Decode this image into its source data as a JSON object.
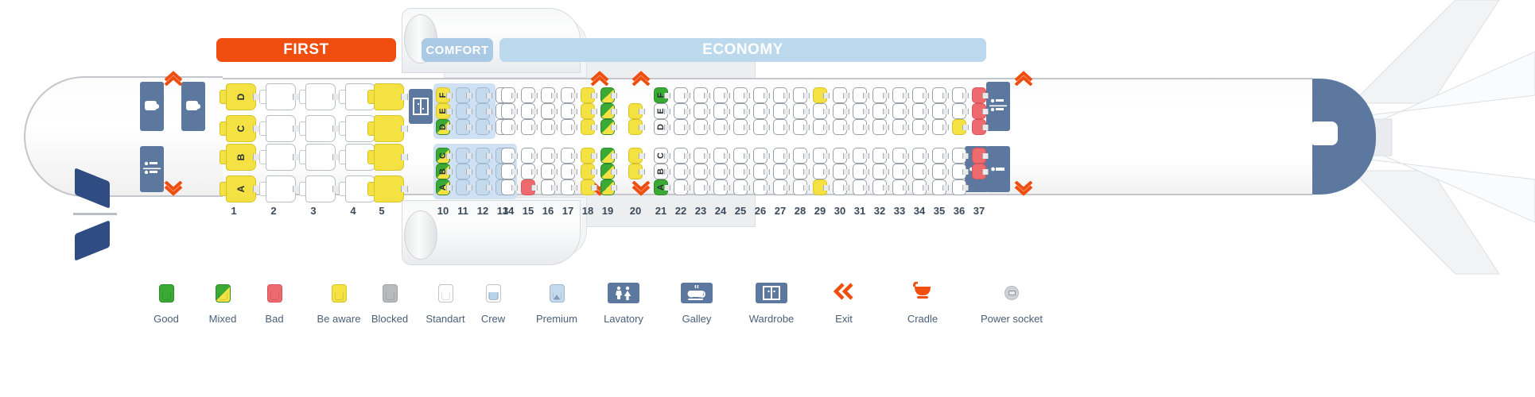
{
  "aircraft": {
    "banners": [
      {
        "id": "first",
        "label": "FIRST",
        "color": "#f04e0e"
      },
      {
        "id": "comfort",
        "label": "COMFORT",
        "color": "#a9c9e4"
      },
      {
        "id": "economy",
        "label": "ECONOMY",
        "color": "#bcd8ec"
      }
    ],
    "row_numbers": [
      "1",
      "2",
      "3",
      "4",
      "5",
      "10",
      "11",
      "12",
      "13",
      "14",
      "15",
      "16",
      "17",
      "18",
      "19",
      "20",
      "21",
      "22",
      "23",
      "24",
      "25",
      "26",
      "27",
      "28",
      "29",
      "30",
      "31",
      "32",
      "33",
      "34",
      "35",
      "36",
      "37"
    ],
    "seat_letters_upper": [
      "F",
      "E",
      "D"
    ],
    "seat_letters_lower": [
      "C",
      "B",
      "A"
    ],
    "first_class": {
      "rows": [
        "1",
        "2",
        "3",
        "4",
        "5"
      ],
      "letters_upper": [
        "D",
        "C"
      ],
      "letters_lower": [
        "B",
        "A"
      ],
      "statuses_upper": [
        [
          "aware",
          "aware"
        ],
        [
          "standart",
          "standart"
        ],
        [
          "standart",
          "standart"
        ],
        [
          "standart",
          "standart"
        ],
        [
          "aware",
          "aware"
        ]
      ],
      "statuses_lower": [
        [
          "aware",
          "aware"
        ],
        [
          "standart",
          "standart"
        ],
        [
          "standart",
          "standart"
        ],
        [
          "standart",
          "standart"
        ],
        [
          "aware",
          "aware"
        ]
      ]
    },
    "economy_rows": [
      {
        "row": "10",
        "upper": [
          "aware",
          "aware",
          "mixed"
        ],
        "lower": [
          "mixed",
          "mixed",
          "mixed"
        ],
        "premium": true
      },
      {
        "row": "11",
        "upper": [
          "premium",
          "premium",
          "premium"
        ],
        "lower": [
          "premium",
          "premium",
          "premium"
        ],
        "premium": true
      },
      {
        "row": "12",
        "upper": [
          "premium",
          "premium",
          "premium"
        ],
        "lower": [
          "premium",
          "premium",
          "premium"
        ],
        "premium": true
      },
      {
        "row": "13",
        "upper": [
          "standart",
          "standart",
          "standart"
        ],
        "lower": [
          "premium",
          "premium",
          "premium"
        ],
        "premium": true
      },
      {
        "row": "14",
        "upper": [
          "standart",
          "standart",
          "standart"
        ],
        "lower": [
          "standart",
          "standart",
          "standart"
        ],
        "premium": false
      },
      {
        "row": "15",
        "upper": [
          "standart",
          "standart",
          "standart"
        ],
        "lower": [
          "standart",
          "standart",
          "bad"
        ],
        "premium": false
      },
      {
        "row": "16",
        "upper": [
          "standart",
          "standart",
          "standart"
        ],
        "lower": [
          "standart",
          "standart",
          "standart"
        ],
        "premium": false
      },
      {
        "row": "17",
        "upper": [
          "standart",
          "standart",
          "standart"
        ],
        "lower": [
          "standart",
          "standart",
          "standart"
        ],
        "premium": false
      },
      {
        "row": "18",
        "upper": [
          "aware",
          "aware",
          "aware"
        ],
        "lower": [
          "aware",
          "aware",
          "aware"
        ],
        "premium": false
      },
      {
        "row": "19",
        "upper": [
          "mixed",
          "mixed",
          "mixed"
        ],
        "lower": [
          "mixed",
          "mixed",
          "mixed"
        ],
        "premium": false
      },
      {
        "row": "20",
        "upper": [
          "none",
          "aware",
          "aware"
        ],
        "lower": [
          "aware",
          "aware",
          "none"
        ],
        "premium": false
      },
      {
        "row": "21",
        "upper": [
          "good",
          "standart",
          "standart"
        ],
        "lower": [
          "standart",
          "standart",
          "good"
        ],
        "premium": false
      },
      {
        "row": "22",
        "upper": [
          "standart",
          "standart",
          "standart"
        ],
        "lower": [
          "standart",
          "standart",
          "standart"
        ],
        "premium": false
      },
      {
        "row": "23",
        "upper": [
          "standart",
          "standart",
          "standart"
        ],
        "lower": [
          "standart",
          "standart",
          "standart"
        ],
        "premium": false
      },
      {
        "row": "24",
        "upper": [
          "standart",
          "standart",
          "standart"
        ],
        "lower": [
          "standart",
          "standart",
          "standart"
        ],
        "premium": false
      },
      {
        "row": "25",
        "upper": [
          "standart",
          "standart",
          "standart"
        ],
        "lower": [
          "standart",
          "standart",
          "standart"
        ],
        "premium": false
      },
      {
        "row": "26",
        "upper": [
          "standart",
          "standart",
          "standart"
        ],
        "lower": [
          "standart",
          "standart",
          "standart"
        ],
        "premium": false
      },
      {
        "row": "27",
        "upper": [
          "standart",
          "standart",
          "standart"
        ],
        "lower": [
          "standart",
          "standart",
          "standart"
        ],
        "premium": false
      },
      {
        "row": "28",
        "upper": [
          "standart",
          "standart",
          "standart"
        ],
        "lower": [
          "standart",
          "standart",
          "standart"
        ],
        "premium": false
      },
      {
        "row": "29",
        "upper": [
          "aware",
          "standart",
          "standart"
        ],
        "lower": [
          "standart",
          "standart",
          "aware"
        ],
        "premium": false
      },
      {
        "row": "30",
        "upper": [
          "standart",
          "standart",
          "standart"
        ],
        "lower": [
          "standart",
          "standart",
          "standart"
        ],
        "premium": false
      },
      {
        "row": "31",
        "upper": [
          "standart",
          "standart",
          "standart"
        ],
        "lower": [
          "standart",
          "standart",
          "standart"
        ],
        "premium": false
      },
      {
        "row": "32",
        "upper": [
          "standart",
          "standart",
          "standart"
        ],
        "lower": [
          "standart",
          "standart",
          "standart"
        ],
        "premium": false
      },
      {
        "row": "33",
        "upper": [
          "standart",
          "standart",
          "standart"
        ],
        "lower": [
          "standart",
          "standart",
          "standart"
        ],
        "premium": false
      },
      {
        "row": "34",
        "upper": [
          "standart",
          "standart",
          "standart"
        ],
        "lower": [
          "standart",
          "standart",
          "standart"
        ],
        "premium": false
      },
      {
        "row": "35",
        "upper": [
          "standart",
          "standart",
          "standart"
        ],
        "lower": [
          "standart",
          "standart",
          "standart"
        ],
        "premium": false
      },
      {
        "row": "36",
        "upper": [
          "standart",
          "standart",
          "aware"
        ],
        "lower": [
          "standart",
          "standart",
          "standart"
        ],
        "premium": false
      },
      {
        "row": "37",
        "upper": [
          "bad",
          "bad",
          "bad"
        ],
        "lower": [
          "bad",
          "bad",
          "none"
        ],
        "premium": false
      }
    ]
  },
  "legend": {
    "items": [
      {
        "id": "good",
        "label": "Good",
        "icon": "seat-good-icon"
      },
      {
        "id": "mixed",
        "label": "Mixed",
        "icon": "seat-mixed-icon"
      },
      {
        "id": "bad",
        "label": "Bad",
        "icon": "seat-bad-icon"
      },
      {
        "id": "aware",
        "label": "Be aware",
        "icon": "seat-be-aware-icon"
      },
      {
        "id": "blocked",
        "label": "Blocked",
        "icon": "seat-blocked-icon"
      },
      {
        "id": "standart",
        "label": "Standart",
        "icon": "seat-standart-icon"
      },
      {
        "id": "crew",
        "label": "Crew",
        "icon": "seat-crew-icon"
      },
      {
        "id": "premium",
        "label": "Premium",
        "icon": "seat-premium-icon"
      },
      {
        "id": "lavatory",
        "label": "Lavatory",
        "icon": "lavatory-icon"
      },
      {
        "id": "galley",
        "label": "Galley",
        "icon": "galley-icon"
      },
      {
        "id": "wardrobe",
        "label": "Wardrobe",
        "icon": "wardrobe-icon"
      },
      {
        "id": "exit",
        "label": "Exit",
        "icon": "exit-icon"
      },
      {
        "id": "cradle",
        "label": "Cradle",
        "icon": "cradle-icon"
      },
      {
        "id": "power_socket",
        "label": "Power socket",
        "icon": "power-socket-icon"
      }
    ]
  },
  "colors": {
    "good": "#3aaa35",
    "bad": "#ef6a6f",
    "aware": "#f4e242",
    "blocked": "#b8bbbe",
    "premium": "#c6daee",
    "service": "#5d789f",
    "exit": "#f04e0e",
    "first_banner": "#f04e0e",
    "comfort_banner": "#a9c9e4",
    "economy_banner": "#bcd8ec"
  }
}
